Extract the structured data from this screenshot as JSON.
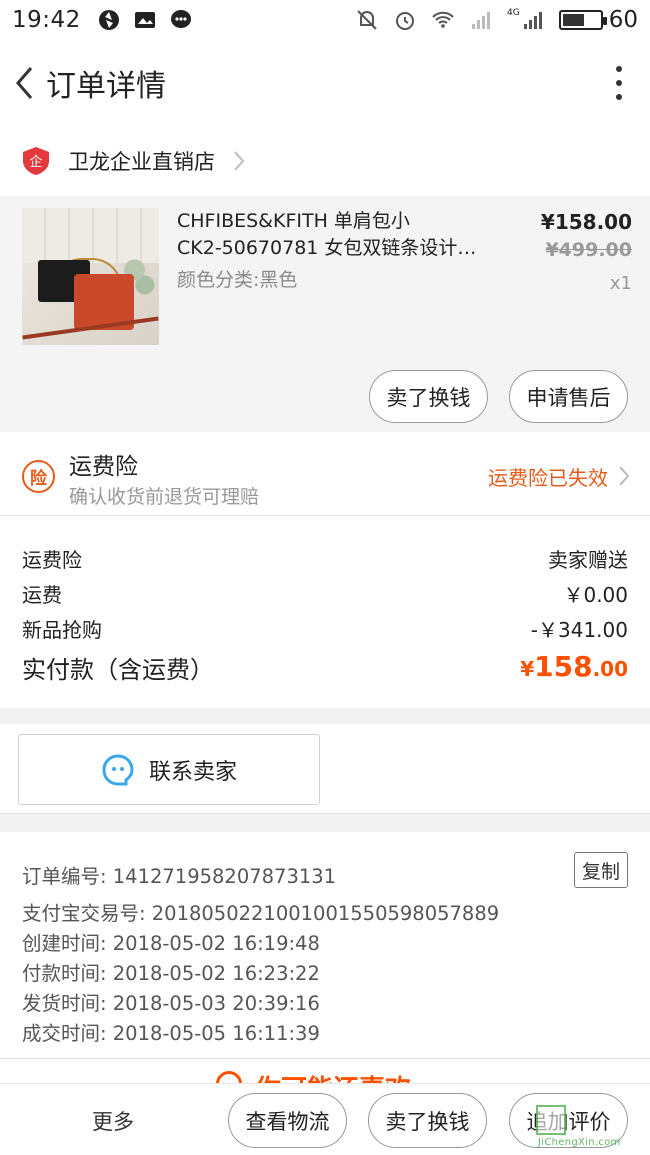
{
  "status_bar": {
    "time": "19:42",
    "network": "4G",
    "battery": "60",
    "battery_level": 0.6
  },
  "header": {
    "title": "订单详情"
  },
  "store": {
    "name": "卫龙企业直销店",
    "badge_char": "企"
  },
  "item": {
    "title_line1": "CHFIBES&KFITH 单肩包小",
    "title_line2": "CK2-50670781 女包双链条设计…",
    "spec": "颜色分类:黑色",
    "price_now": "¥158.00",
    "price_old": "¥499.00",
    "qty": "x1",
    "btn_sell": "卖了换钱",
    "btn_after_sale": "申请售后"
  },
  "insurance": {
    "icon_char": "险",
    "title": "运费险",
    "subtitle": "确认收货前退货可理赔",
    "status": "运费险已失效"
  },
  "fees": {
    "rows": [
      {
        "label": "运费险",
        "value": "卖家赠送"
      },
      {
        "label": "运费",
        "value": "￥0.00"
      },
      {
        "label": "新品抢购",
        "value": "-￥341.00"
      }
    ],
    "total_label": "实付款（含运费）",
    "total_currency": "¥",
    "total_int": "158",
    "total_dec": ".00"
  },
  "contact": {
    "label": "联系卖家"
  },
  "order_info": {
    "order_no": "订单编号: 141271958207873131",
    "alipay_no": "支付宝交易号: 2018050221001001550598057889",
    "created": "创建时间: 2018-05-02 16:19:48",
    "paid": "付款时间: 2018-05-02 16:23:22",
    "shipped": "发货时间: 2018-05-03 20:39:16",
    "completed": "成交时间: 2018-05-05 16:11:39",
    "copy_label": "复制"
  },
  "peek": {
    "text": "你可能还喜欢"
  },
  "bottom_bar": {
    "more": "更多",
    "logistics": "查看物流",
    "sell": "卖了换钱",
    "review": "追加评价"
  },
  "watermark": {
    "text": "JiChengXin.com"
  },
  "colors": {
    "accent": "#ff5000",
    "insurance": "#e55b1a",
    "contact_icon": "#3aa8e8"
  }
}
